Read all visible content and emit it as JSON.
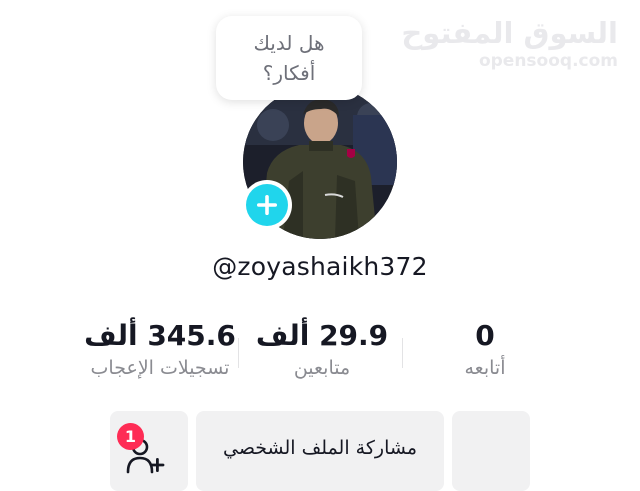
{
  "watermark": {
    "arabic": "السوق المفتوح",
    "latin": "opensooq.com"
  },
  "prompt_bubble": {
    "line1": "هل لديك",
    "line2": "أفكار؟"
  },
  "profile": {
    "username": "@zoyashaikh372"
  },
  "stats": {
    "likes": {
      "value": "345.6 ألف",
      "label": "تسجيلات الإعجاب"
    },
    "followers": {
      "value": "29.9 ألف",
      "label": "متابعين"
    },
    "following": {
      "value": "0",
      "label": "أتابعه"
    }
  },
  "actions": {
    "share_profile_label": "مشاركة الملف الشخصي",
    "friend_requests_badge": "1"
  },
  "colors": {
    "accent_cyan": "#20d5ec",
    "badge_red": "#fe2c55",
    "text_primary": "#161823",
    "text_secondary": "#8a8b91",
    "button_bg": "#f1f1f2"
  },
  "icons": [
    "plus-icon",
    "add-friend-icon"
  ]
}
